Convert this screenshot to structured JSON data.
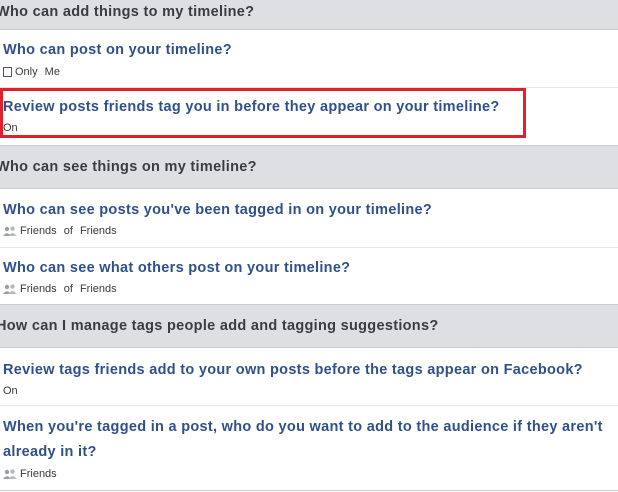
{
  "sections": [
    {
      "header": "Who can add things to my timeline?"
    },
    {
      "header": "Who can see things on my timeline?"
    },
    {
      "header": "How can I manage tags people add and tagging suggestions?"
    }
  ],
  "settings": {
    "post_on_timeline": {
      "title": "Who can post on your timeline?",
      "value": "Only Me",
      "icon": "lock-icon"
    },
    "review_tag_posts": {
      "title": "Review posts friends tag you in before they appear on your timeline?",
      "value": "On"
    },
    "see_tagged_posts": {
      "title": "Who can see posts you've been tagged in on your timeline?",
      "value": "Friends of Friends",
      "icon": "friends-icon"
    },
    "see_others_posts": {
      "title": "Who can see what others post on your timeline?",
      "value": "Friends of Friends",
      "icon": "friends-icon"
    },
    "review_tags": {
      "title": "Review tags friends add to your own posts before the tags appear on Facebook?",
      "value": "On"
    },
    "tagged_audience": {
      "title_line1": "When you're tagged in a post, who do you want to add to the audience if they aren't",
      "title_line2": "already in it?",
      "value": "Friends",
      "icon": "friends-icon"
    }
  },
  "colors": {
    "highlight": "#e0202a",
    "link": "#30508c",
    "header_bg": "#dddfe2"
  }
}
